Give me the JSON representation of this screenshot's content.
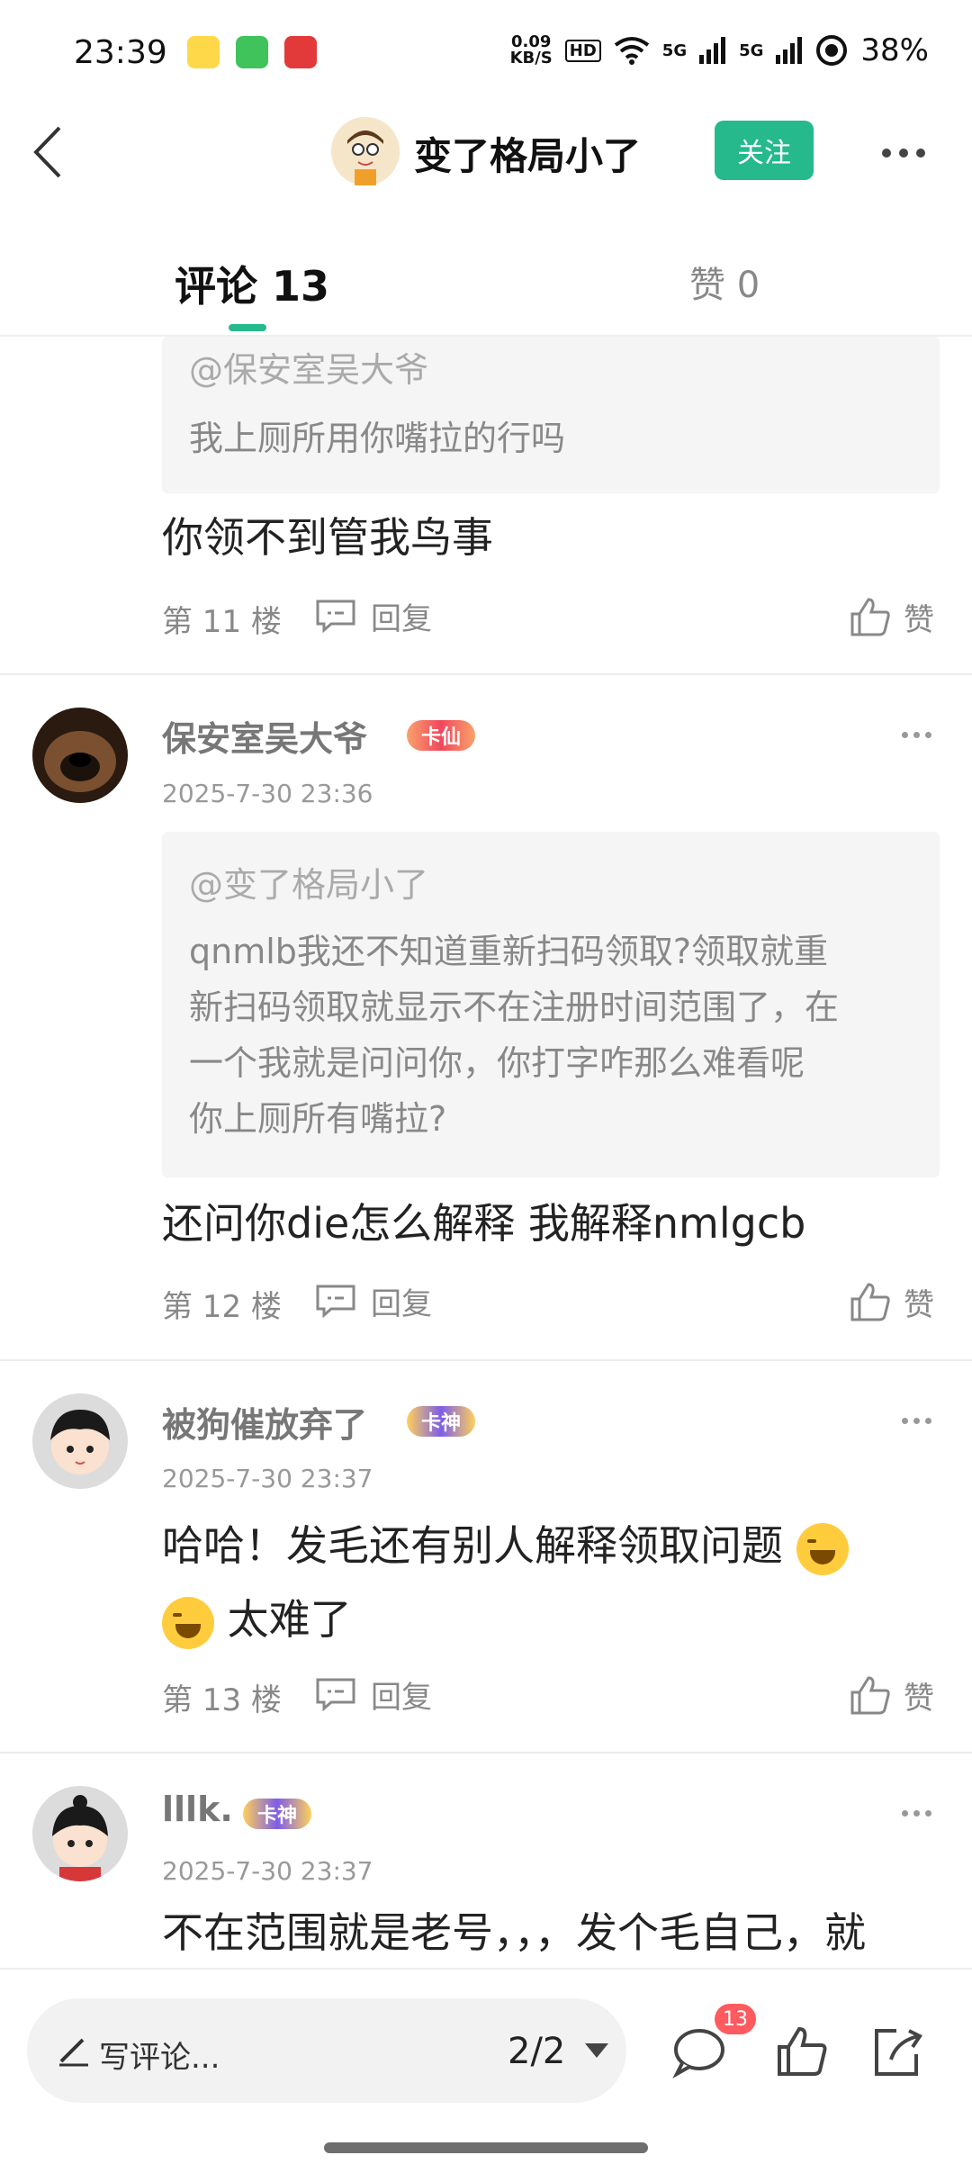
{
  "status_bar": {
    "time": "23:39",
    "speed_value": "0.09",
    "speed_unit": "KB/S",
    "hd": "HD",
    "network1": "5G",
    "network2": "5G",
    "battery": "38%",
    "app_icons": [
      "app-icon-1",
      "app-icon-2",
      "app-icon-3"
    ]
  },
  "header": {
    "username": "变了格局小了",
    "follow_label": "关注"
  },
  "tabs": {
    "comments_label": "评论 13",
    "likes_label": "赞 0"
  },
  "comments": [
    {
      "quote_at": "@保安室吴大爷",
      "quote_text": "我上厕所用你嘴拉的行吗",
      "text": "你领不到管我鸟事",
      "floor": "第 11 楼",
      "reply_label": "回复",
      "like_label": "赞"
    },
    {
      "username": "保安室吴大爷",
      "badge": "卡仙",
      "time": "2025-7-30 23:36",
      "quote_at": "@变了格局小了",
      "quote_lines": [
        "qnmlb我还不知道重新扫码领取?领取就重",
        "新扫码领取就显示不在注册时间范围了，在",
        "一个我就是问问你，你打字咋那么难看呢",
        "你上厕所有嘴拉?"
      ],
      "text": "还问你die怎么解释 我解释nmlgcb",
      "floor": "第 12 楼",
      "reply_label": "回复",
      "like_label": "赞"
    },
    {
      "username": "被狗催放弃了",
      "badge": "卡神",
      "time": "2025-7-30 23:37",
      "text_line1": "哈哈！发毛还有别人解释领取问题",
      "text_line2": "太难了",
      "floor": "第 13 楼",
      "reply_label": "回复",
      "like_label": "赞"
    },
    {
      "username": "lllk.",
      "badge": "卡神",
      "time": "2025-7-30 23:37",
      "text": "不在范围就是老号，，，发个毛自己，就"
    }
  ],
  "bottom_bar": {
    "write_label": "写评论...",
    "page_indicator": "2/2",
    "comment_count": "13"
  },
  "colors": {
    "accent": "#25b98c",
    "badge_red": "#ff5a5f"
  }
}
